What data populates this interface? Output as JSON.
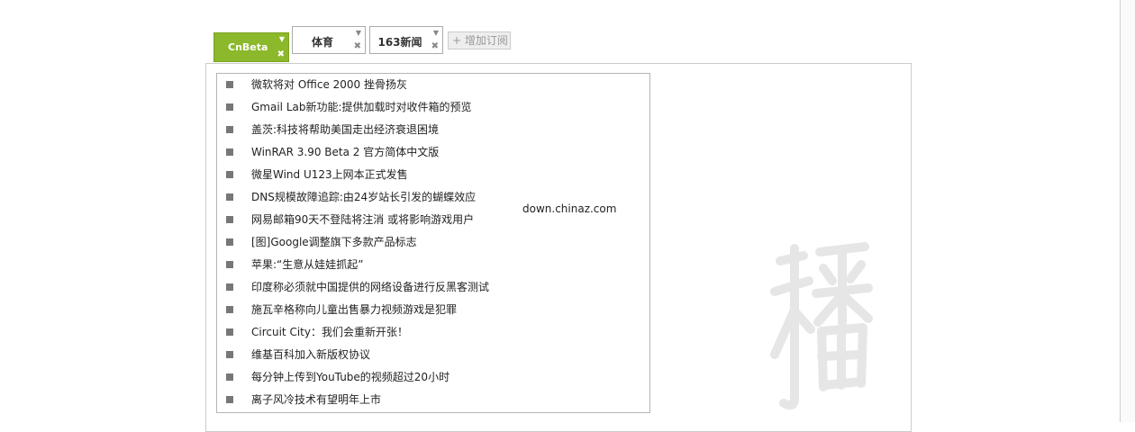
{
  "tabs": [
    {
      "label": "CnBeta",
      "active": true
    },
    {
      "label": "体育",
      "active": false
    },
    {
      "label": "163新闻",
      "active": false
    }
  ],
  "tab_icons": {
    "menu": "▼",
    "close": "✖"
  },
  "add_subscription": {
    "icon": "+",
    "label": "增加订阅"
  },
  "news": [
    "微软将对 Office 2000 挫骨扬灰",
    "Gmail Lab新功能:提供加载时对收件箱的预览",
    "盖茨:科技将帮助美国走出经济衰退困境",
    "WinRAR 3.90 Beta 2 官方简体中文版",
    "微星Wind U123上网本正式发售",
    "DNS规模故障追踪:由24岁站长引发的蝴蝶效应",
    "网易邮箱90天不登陆将注消  或将影响游戏用户",
    "[图]Google调整旗下多款产品标志",
    "苹果:“生意从娃娃抓起”",
    "印度称必须就中国提供的网络设备进行反黑客测试",
    "施瓦辛格称向儿童出售暴力视频游戏是犯罪",
    "Circuit City：我们会重新开张！",
    "维基百科加入新版权协议",
    "每分钟上传到YouTube的视频超过20小时",
    "离子风冷技术有望明年上市"
  ],
  "watermark": "down.chinaz.com",
  "colors": {
    "active_tab": "#8cb82b",
    "bullet": "#777777",
    "glyph": "#e6e6e6"
  }
}
